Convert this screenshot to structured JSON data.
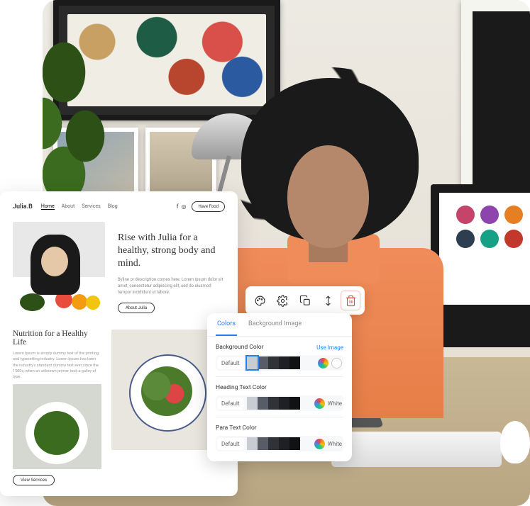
{
  "site": {
    "brand": "Julia.B",
    "nav": [
      "Home",
      "About",
      "Services",
      "Blog"
    ],
    "cta": "Have Food",
    "hero_title": "Rise with Julia for a healthy, strong body and mind.",
    "hero_sub": "Byline or description comes here. Lorem ipsum dolor sit amet, consectetur adipiscing elit, sed do eiusmod tempor incididunt ut labore.",
    "hero_btn": "About Julia",
    "section2_title": "Nutrition for a Healthy Life",
    "section2_sub": "Lorem Ipsum is simply dummy text of the printing and typesetting industry. Lorem Ipsum has been the industry's standard dummy text ever since the 1500s, when an unknown printer took a galley of type.",
    "section2_btn": "View Services"
  },
  "toolbar": {
    "palette": "Style",
    "settings": "Settings",
    "copy": "Duplicate",
    "move": "Move",
    "delete": "Delete"
  },
  "panel": {
    "tabs": {
      "colors": "Colors",
      "bg": "Background Image"
    },
    "use_image": "Use Image",
    "sections": [
      {
        "label": "Background Color",
        "default": "Default",
        "value": "White"
      },
      {
        "label": "Heading Text Color",
        "default": "Default",
        "value": "White"
      },
      {
        "label": "Para Text Color",
        "default": "Default",
        "value": "White"
      }
    ],
    "swatches": [
      "#c8cdd4",
      "#575c66",
      "#303238",
      "#1e2025",
      "#111214"
    ]
  }
}
